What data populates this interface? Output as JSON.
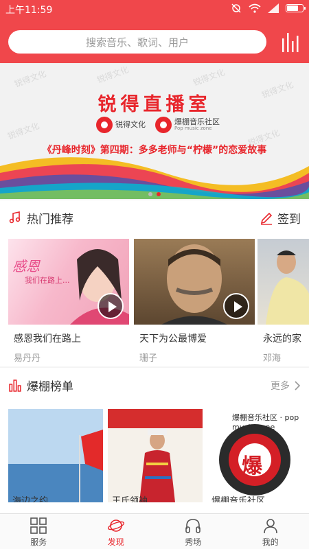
{
  "status_bar": {
    "time": "上午11:59"
  },
  "header": {
    "search_placeholder": "搜索音乐、歌词、用户"
  },
  "banner": {
    "title": "锐得直播室",
    "logo_left": "锐得文化",
    "logo_right": "爆棚音乐社区",
    "logo_right_sub": "Pop music zone",
    "subtitle": "《丹峰时刻》第四期：多多老师与“柠檬”的恋爱故事",
    "watermark": "锐得文化"
  },
  "hot": {
    "title": "热门推荐",
    "action": "签到",
    "items": [
      {
        "name": "感恩我们在路上",
        "artist": "易丹丹",
        "cover_text": "感恩",
        "cover_text2": "我们在路上..."
      },
      {
        "name": "天下为公最博爱",
        "artist": "珊子"
      },
      {
        "name": "永远的家",
        "artist": "邓海"
      }
    ]
  },
  "rank": {
    "title": "爆棚榜单",
    "more": "更多",
    "items": [
      {
        "caption": "海边之约"
      },
      {
        "caption": "王氏领袖"
      },
      {
        "caption": "爆棚音乐社区",
        "cover_text": "爆",
        "cover_ring": "爆棚音乐社区 · pop music zone"
      }
    ]
  },
  "nav": [
    {
      "label": "服务",
      "icon": "grid-icon"
    },
    {
      "label": "发现",
      "icon": "planet-icon"
    },
    {
      "label": "秀场",
      "icon": "headphones-icon"
    },
    {
      "label": "我的",
      "icon": "person-icon"
    }
  ],
  "colors": {
    "accent": "#f0474b",
    "brand_red": "#e8262c"
  }
}
